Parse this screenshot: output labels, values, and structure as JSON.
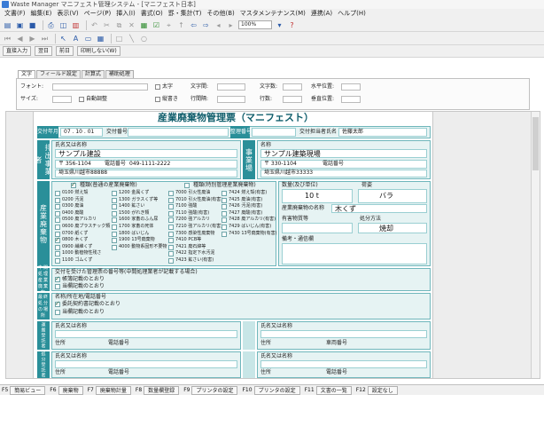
{
  "window": {
    "title": "Waste Manager マニフェスト管理システム - [マニフェスト日本]"
  },
  "menu": [
    "文書(F)",
    "編集(E)",
    "表示(V)",
    "ページ(P)",
    "挿入(I)",
    "書式(O)",
    "罫・集計(T)",
    "その他(B)",
    "マスタメンテナンス(M)",
    "連携(A)",
    "ヘルプ(H)"
  ],
  "toolbar": {
    "zoom": "100%"
  },
  "mode_buttons": [
    "直接入力",
    "翌日",
    "前日",
    "印刷しない(W)"
  ],
  "format_tabs": [
    "文字",
    "フィールド設定",
    "計算式",
    "補助処理"
  ],
  "format_panel": {
    "font_label": "フォント:",
    "size_label": "サイズ:",
    "auto_adjust_label": "自動調整",
    "bold_label": "太字",
    "vertical_label": "縦書き",
    "char_spacing_label": "文字間:",
    "line_spacing_label": "行間隔:",
    "char_count_label": "文字数:",
    "line_count_label": "行数:",
    "h_pos_label": "水平位置:",
    "v_pos_label": "垂直位置:"
  },
  "form": {
    "title": "産業廃棄物管理票（マニフェスト）",
    "issue_date_label": "交付年月日",
    "issue_date_value": "07 . 10 . 01",
    "issue_no_label": "交付番号",
    "reg_no_label": "整理番号",
    "staff_label": "交付担当者",
    "staff_name_label": "氏名",
    "staff_name": "佐藤太郎",
    "operator_section": "排出事業者",
    "operator_name_label": "氏名又は名称",
    "operator_name": "サンプル建設",
    "operator_postal": "〒 356-1104",
    "operator_phone_label": "電話番号",
    "operator_phone": "049-1111-2222",
    "operator_address": "埼玉県川越市88888",
    "site_section": "事業場",
    "site_name_label": "名称",
    "site_name": "サンプル建築現場",
    "site_postal": "〒 330-1104",
    "site_phone_label": "電話番号",
    "site_address": "埼玉県川越市33333",
    "waste_section": "産業廃棄物",
    "waste_group1_header": "種類(普通の産業廃棄物)",
    "waste_group2_header": "種類(特別管理産業廃棄物)",
    "quantity_header": "数量(及び単位)",
    "form_header": "荷姿",
    "quantity_value": "10 t",
    "form_value": "バラ",
    "waste_name_header": "産業廃棄物の名称",
    "waste_name_value": "木くず",
    "hazard_header": "有害物質等",
    "disposal_method_header": "処分方法",
    "disposal_method_value": "焼却",
    "notes_header": "備考・通信欄",
    "waste_types_col1": [
      "0100 燃え殻",
      "0200 汚泥",
      "0300 廃油",
      "0400 廃酸",
      "0500 廃アルカリ",
      "0600 廃プラスチック類",
      "0700 紙くず",
      "0800 木くず",
      "0900 繊維くず",
      "1000 動植物性残さ",
      "1100 ゴムくず"
    ],
    "waste_types_col2": [
      "1200 金属くず",
      "1300 ガラスくず等",
      "1400 鉱さい",
      "1500 がれき類",
      "1600 家畜のふん尿",
      "1700 家畜の死体",
      "1800 ばいじん",
      "1900 13号廃棄物",
      "4000 動物系固形不要物"
    ],
    "waste_types_col3": [
      "7000 引火性廃油",
      "7010 引火性廃油(有害)",
      "7100 強酸",
      "7110 強酸(有害)",
      "7200 強アルカリ",
      "7210 強アルカリ(有害)",
      "7300 感染性廃棄物",
      "7410 PCB等",
      "7421 廃石綿等",
      "7422 指定下水汚泥",
      "7423 鉱さい(有害)"
    ],
    "waste_types_col4": [
      "7424 燃え殻(有害)",
      "7425 廃油(有害)",
      "7426 汚泥(有害)",
      "7427 廃酸(有害)",
      "7428 廃アルカリ(有害)",
      "7429 ばいじん(有害)",
      "7430 13号廃棄物(有害)"
    ],
    "mid_process_label": "中間処理産業廃棄物",
    "mid_process_lines": [
      "交付を受けた管理票の番号等(中間処理業者が記載する場合)",
      "帳簿記載のとおり",
      "当欄記載のとおり"
    ],
    "final_disposal_label": "最終処分の場所",
    "final_disposal_lines": [
      "名称/所在地/電話番号",
      "委託契約書記載のとおり",
      "当欄記載のとおり"
    ],
    "transport_label": "運搬受託者",
    "disposal_label": "処分受託者",
    "name_label": "氏名又は名称",
    "address_label": "住所",
    "phone_label": "電話番号",
    "car_no_label": "車両番号"
  },
  "fn_keys": [
    {
      "key": "F5",
      "label": "簡易ビュー"
    },
    {
      "key": "F6",
      "label": "廃棄物"
    },
    {
      "key": "F7",
      "label": "廃棄物計量"
    },
    {
      "key": "F8",
      "label": "数量欄登録"
    },
    {
      "key": "F9",
      "label": "プリンタの設定"
    },
    {
      "key": "F10",
      "label": "プリンタの設定"
    },
    {
      "key": "F11",
      "label": "文書の一覧"
    },
    {
      "key": "F12",
      "label": "設定なし"
    }
  ]
}
